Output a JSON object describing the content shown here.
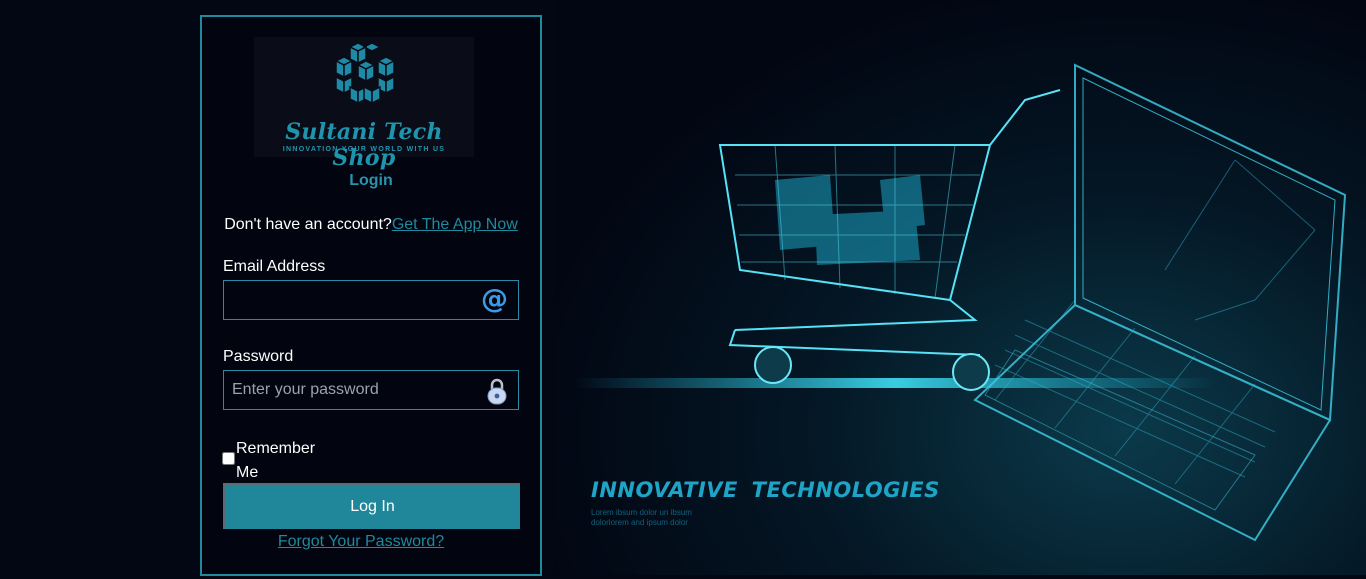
{
  "logo": {
    "title": "Sultani Tech Shop",
    "tagline": "INNOVATION YOUR WORLD WITH US"
  },
  "login": {
    "heading": "Login",
    "signup_prompt": "Don't have an account?",
    "signup_link": "Get The App Now",
    "email_label": "Email Address",
    "email_value": "",
    "password_label": "Password",
    "password_placeholder": "Enter your password",
    "remember_label": "Remember Me",
    "remember_checked": false,
    "login_button": "Log In",
    "forgot_link": "Forgot Your Password?",
    "email_icon": "at-sign-icon",
    "password_icon": "padlock-icon"
  },
  "hero": {
    "title": "INNOVATIVE  TECHNOLOGIES",
    "subtitle": "Lorem ibsum dolor un ibsum dolorlorem and ipsum dolor"
  },
  "colors": {
    "background": "#030613",
    "accent": "#1e8a9c",
    "button": "#1f8799",
    "link": "#1e8a9c"
  }
}
